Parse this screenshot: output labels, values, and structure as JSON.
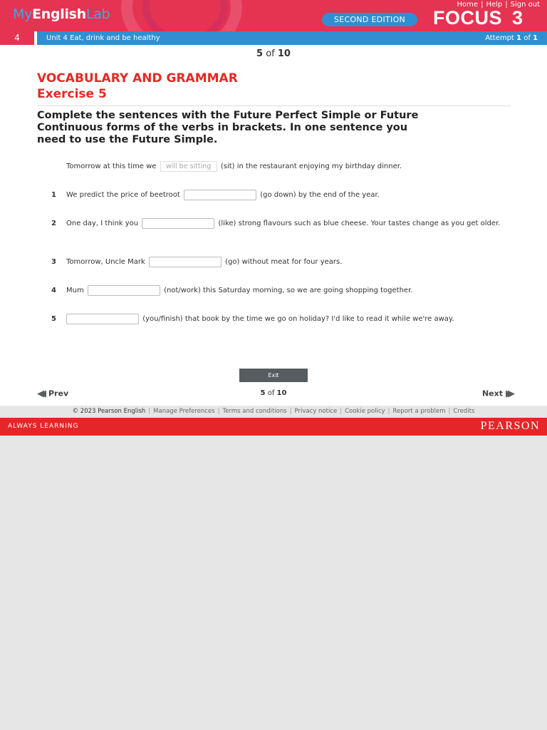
{
  "header": {
    "logo": {
      "my": "My",
      "english": "English",
      "lab": "Lab"
    },
    "links": [
      "Home",
      "Help",
      "Sign out"
    ],
    "edition": "SECOND EDITION",
    "product": "FOCUS",
    "level": "3"
  },
  "unit": {
    "number": "4",
    "title": "Unit 4 Eat, drink and be healthy",
    "attempt_label": "Attempt",
    "attempt_current": "1",
    "attempt_of": "of",
    "attempt_total": "1"
  },
  "pager": {
    "current": "5",
    "of": "of",
    "total": "10"
  },
  "exercise": {
    "section": "VOCABULARY AND GRAMMAR",
    "title": "Exercise 5",
    "instructions": "Complete the sentences with the Future Perfect Simple or Future Continuous forms of the verbs in brackets. In one sentence you need to use the Future Simple.",
    "example": {
      "before": "Tomorrow at this time we",
      "answer": "will be sitting",
      "after": "(sit) in the restaurant enjoying my birthday dinner."
    },
    "items": [
      {
        "number": "1",
        "before": "We predict the price of beetroot",
        "after": "(go down) by the end of the year.",
        "value": ""
      },
      {
        "number": "2",
        "before": "One day, I think you",
        "after": "(like) strong flavours such as blue cheese. Your tastes change as you get older.",
        "value": ""
      },
      {
        "number": "3",
        "before": "Tomorrow, Uncle Mark",
        "after": "(go) without meat for four years.",
        "value": ""
      },
      {
        "number": "4",
        "before": "Mum",
        "after": "(not/work) this Saturday morning, so we are going shopping together.",
        "value": ""
      },
      {
        "number": "5",
        "before": "",
        "after": "(you/finish) that book by the time we go on holiday? I'd like to read it while we're away.",
        "value": ""
      }
    ]
  },
  "buttons": {
    "exit": "Exit",
    "prev": "Prev",
    "next": "Next"
  },
  "footer": {
    "copyright": "© 2023 Pearson English",
    "links": [
      "Manage Preferences",
      "Terms and conditions",
      "Privacy notice",
      "Cookie policy",
      "Report a problem",
      "Credits"
    ],
    "tagline": "ALWAYS LEARNING",
    "brand": "PEARSON"
  },
  "colors": {
    "header_red": "#e53352",
    "header_blue": "#2f8fd0",
    "title_red": "#e22a24",
    "footer_red": "#e32728"
  }
}
